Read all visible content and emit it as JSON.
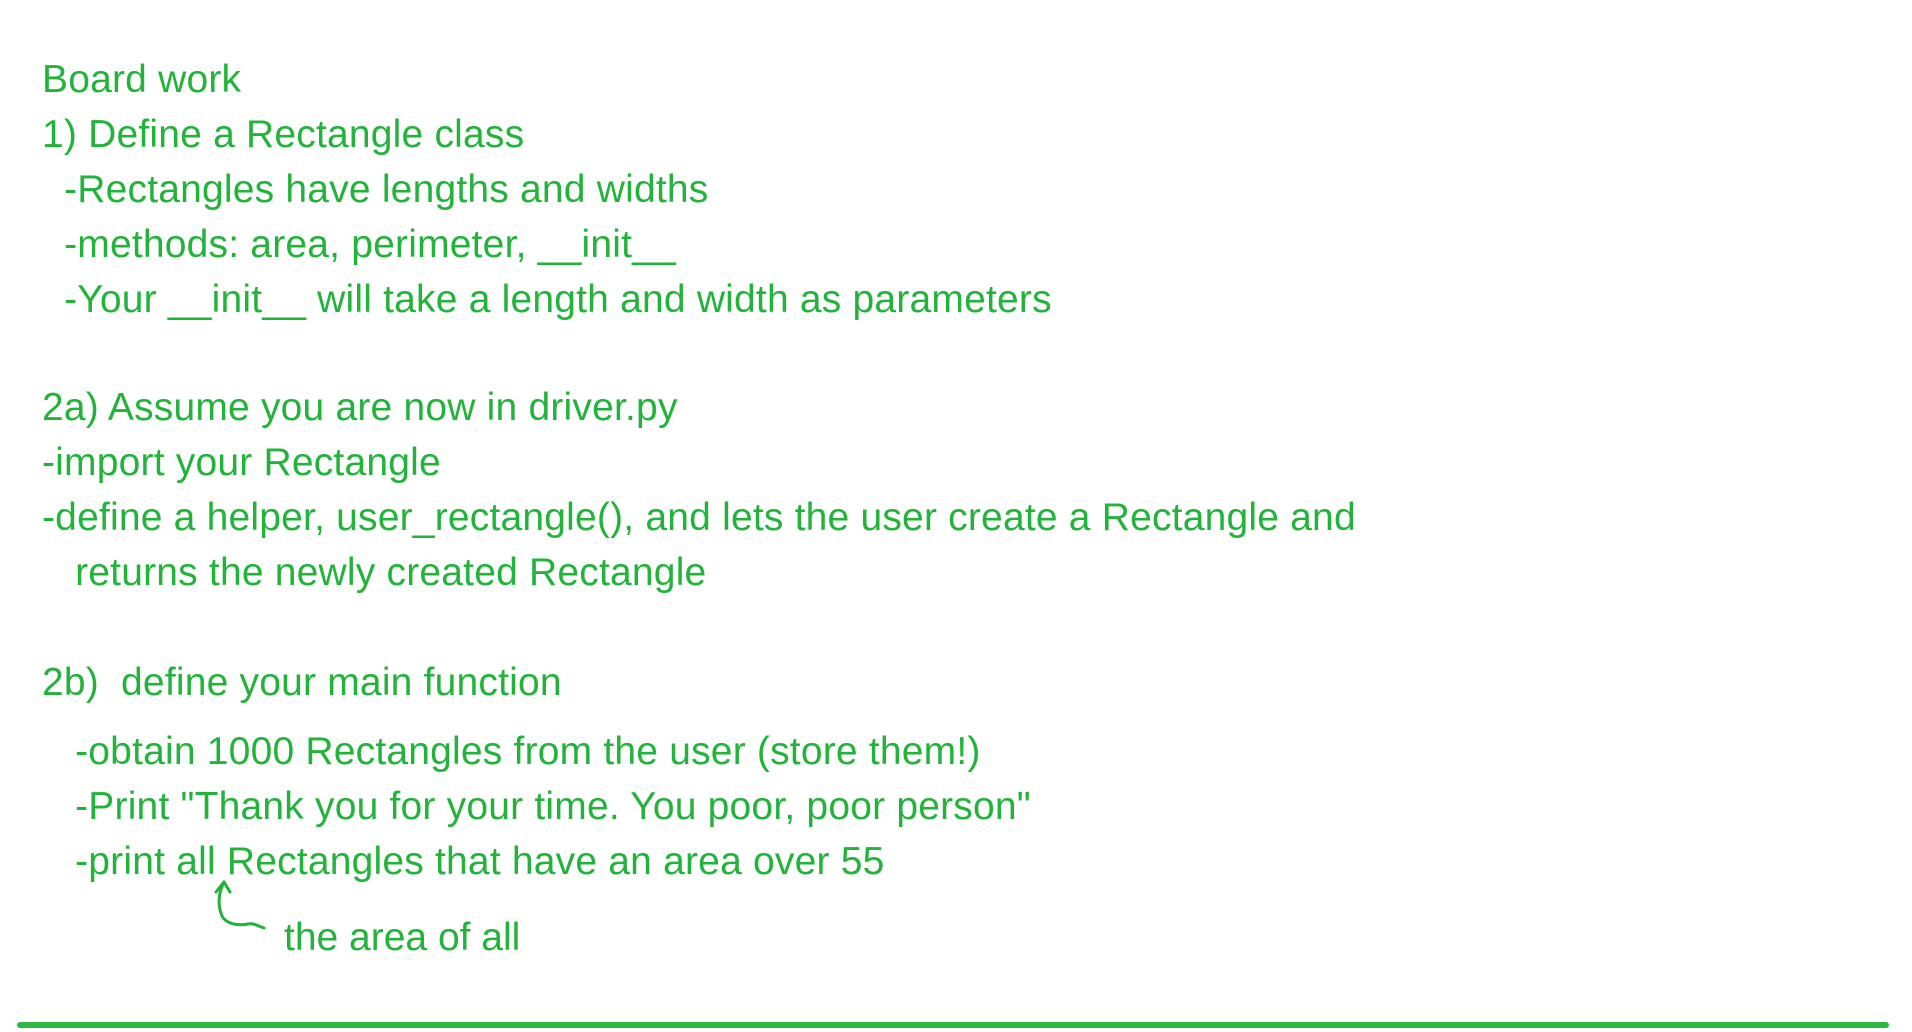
{
  "ink_color": "#22b33a",
  "rule_color": "#2cb843",
  "lines": [
    "Board work",
    "1) Define a Rectangle class",
    "  -Rectangles have lengths and widths",
    "  -methods: area, perimeter, __init__",
    "  -Your __init__ will take a length and width as parameters",
    "2a) Assume you are now in driver.py",
    "-import your Rectangle",
    "-define a helper, user_rectangle(), and lets the user create a Rectangle and",
    "   returns the newly created Rectangle",
    "2b)  define your main function",
    "   -obtain 1000 Rectangles from the user (store them!)",
    "   -Print \"Thank you for your time. You poor, poor person\"",
    "   -print all Rectangles that have an area over 55"
  ],
  "annotation": {
    "text": "the area of all",
    "icon": "hand-drawn-arrow-icon"
  }
}
